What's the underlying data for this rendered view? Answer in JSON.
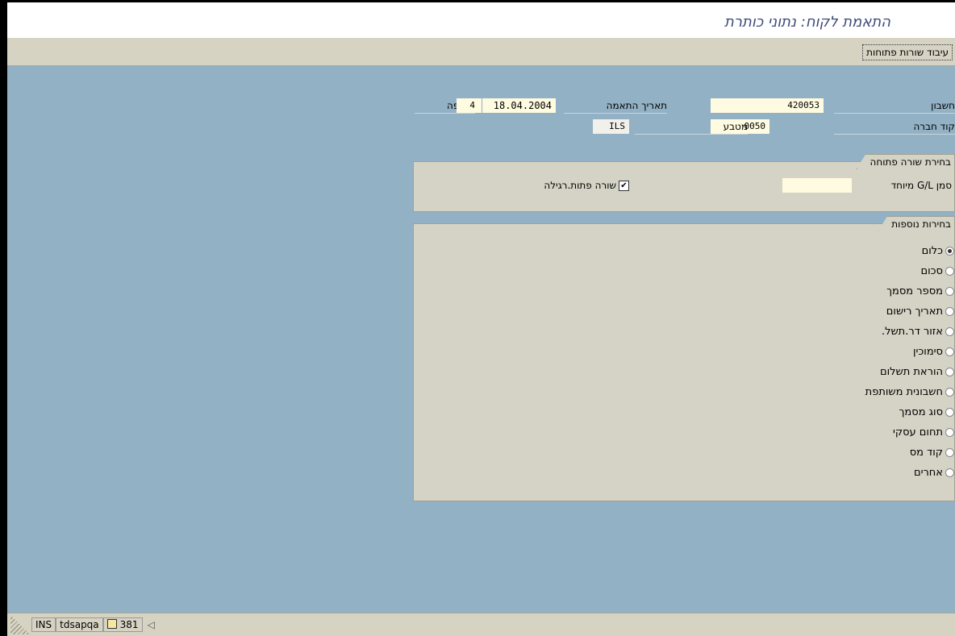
{
  "title": "התאמת לקוח: נתוני כותרת",
  "toolbar": {
    "process_open_items": "עיבוד שורות פתוחות"
  },
  "header": {
    "account_label": "חשבון",
    "account_value": "420053",
    "company_code_label": "קוד חברה",
    "company_code_value": "0050",
    "clearing_date_label": "תאריך התאמה",
    "clearing_date_value": "18.04.2004",
    "currency_label": "מטבע",
    "currency_value": "ILS",
    "period_label": "תקופה",
    "period_value": "4"
  },
  "open_item_selection": {
    "title": "בחירת שורה פתוחה",
    "special_gl_label": "סמן G/L מיוחד",
    "special_gl_value": "",
    "normal_oi_label": "שורה פתות.רגילה",
    "normal_oi_checked": true
  },
  "additional_selections": {
    "title": "בחירות נוספות",
    "options": [
      {
        "label": "כלום",
        "selected": true
      },
      {
        "label": "סכום",
        "selected": false
      },
      {
        "label": "מספר מסמך",
        "selected": false
      },
      {
        "label": "תאריך רישום",
        "selected": false
      },
      {
        "label": "אזור דר.תשל.",
        "selected": false
      },
      {
        "label": "סימוכין",
        "selected": false
      },
      {
        "label": "הוראת תשלום",
        "selected": false
      },
      {
        "label": "חשבונית משותפת",
        "selected": false
      },
      {
        "label": "סוג מסמך",
        "selected": false
      },
      {
        "label": "תחום עסקי",
        "selected": false
      },
      {
        "label": "קוד מס",
        "selected": false
      },
      {
        "label": "אחרים",
        "selected": false
      }
    ]
  },
  "status_bar": {
    "mode": "INS",
    "server": "tdsapqa",
    "session": "381"
  }
}
